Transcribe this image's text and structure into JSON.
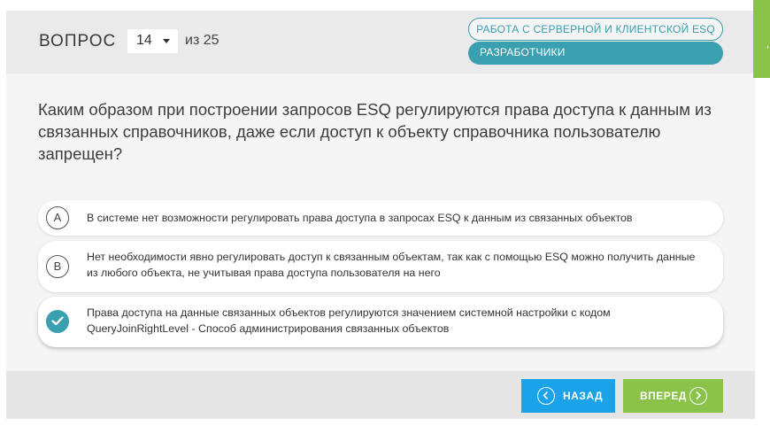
{
  "header": {
    "question_label": "ВОПРОС",
    "current_question": "14",
    "of_text": "из 25",
    "tags": [
      "РАБОТА С СЕРВЕРНОЙ И КЛИЕНТСКОЙ ESQ",
      "РАЗРАБОТЧИКИ"
    ]
  },
  "question": {
    "text": "Каким образом при построении запросов ESQ регулируются права доступа к данным из связанных справочников, даже если доступ к объекту справочника пользователю запрещен?"
  },
  "options": [
    {
      "badge": "A",
      "text": "В системе нет возможности регулировать права доступа в запросах ESQ к данным из связанных объектов"
    },
    {
      "badge": "B",
      "text": "Нет необходимости явно регулировать доступ к связанным объектам, так как с помощью ESQ можно получить данные из любого объекта, не учитывая права доступа пользователя на него"
    },
    {
      "badge": "",
      "text": "Права доступа на данные связанных объектов регулируются значением системной настройки с кодом QueryJoinRightLevel - Способ администрирования связанных объектов",
      "selected": true
    }
  ],
  "footer": {
    "back_label": "НАЗАД",
    "next_label": "ВПЕРЕД"
  },
  "colors": {
    "accent": "#3a9fae",
    "back_button": "#1aa3e8",
    "next_button": "#8bc34a"
  }
}
